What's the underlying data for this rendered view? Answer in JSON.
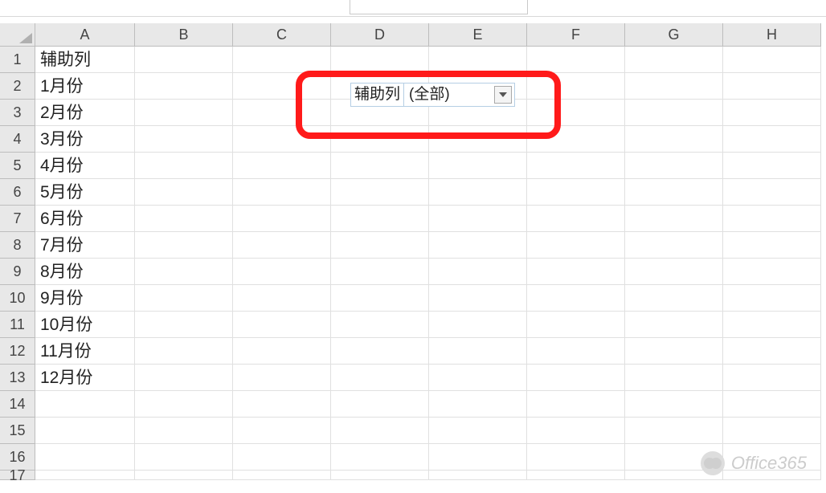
{
  "columns": [
    "A",
    "B",
    "C",
    "D",
    "E",
    "F",
    "G",
    "H"
  ],
  "row_numbers": [
    1,
    2,
    3,
    4,
    5,
    6,
    7,
    8,
    9,
    10,
    11,
    12,
    13,
    14,
    15,
    16,
    17
  ],
  "colA_values": {
    "1": "辅助列",
    "2": "1月份",
    "3": "2月份",
    "4": "3月份",
    "5": "4月份",
    "6": "5月份",
    "7": "6月份",
    "8": "7月份",
    "9": "8月份",
    "10": "9月份",
    "11": "10月份",
    "12": "11月份",
    "13": "12月份"
  },
  "pivot": {
    "field_label": "辅助列",
    "value": "(全部)"
  },
  "watermark": {
    "text": "Office365"
  }
}
